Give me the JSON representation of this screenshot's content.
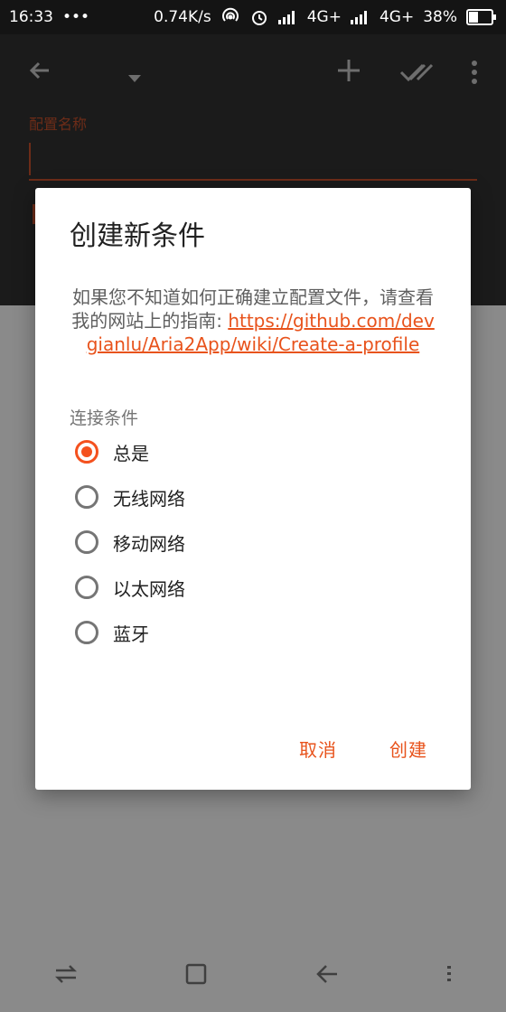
{
  "status_bar": {
    "time": "16:33",
    "dots": "•••",
    "speed": "0.74K/s",
    "net1": "4G+",
    "net2": "4G+",
    "battery": "38%"
  },
  "screen": {
    "field_label": "配置名称"
  },
  "dialog": {
    "title": "创建新条件",
    "message_text": "如果您不知道如何正确建立配置文件，请查看我的网站上的指南: ",
    "message_link": "https://github.com/devgianlu/Aria2App/wiki/Create-a-profile",
    "section_label": "连接条件",
    "options": [
      {
        "label": "总是",
        "checked": true
      },
      {
        "label": "无线网络",
        "checked": false
      },
      {
        "label": "移动网络",
        "checked": false
      },
      {
        "label": "以太网络",
        "checked": false
      },
      {
        "label": "蓝牙",
        "checked": false
      }
    ],
    "cancel_label": "取消",
    "create_label": "创建"
  },
  "colors": {
    "accent": "#f4511e",
    "link": "#e8531c"
  }
}
